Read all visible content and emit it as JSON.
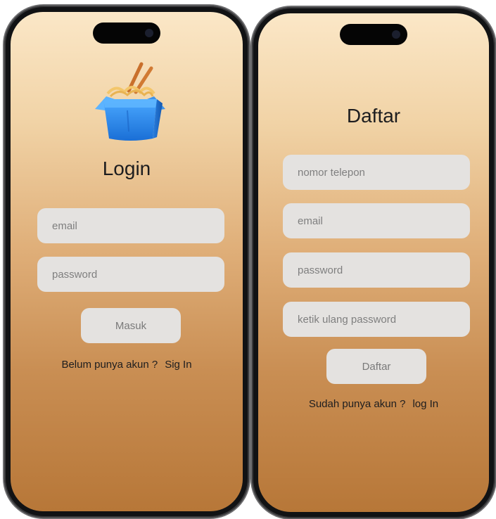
{
  "login": {
    "title": "Login",
    "email_placeholder": "email",
    "password_placeholder": "password",
    "submit_label": "Masuk",
    "footer_text": "Belum punya akun ?",
    "footer_link": "Sig In"
  },
  "daftar": {
    "title": "Daftar",
    "phone_placeholder": "nomor telepon",
    "email_placeholder": "email",
    "password_placeholder": "password",
    "confirm_placeholder": "ketik ulang password",
    "submit_label": "Daftar",
    "footer_text": "Sudah punya akun ?",
    "footer_link": "log In"
  },
  "icons": {
    "logo": "noodle-box-icon"
  },
  "colors": {
    "gradient_top": "#fbe7c7",
    "gradient_bottom": "#b77738",
    "input_bg": "#e4e2e0",
    "logo_blue": "#2f8ff0"
  }
}
